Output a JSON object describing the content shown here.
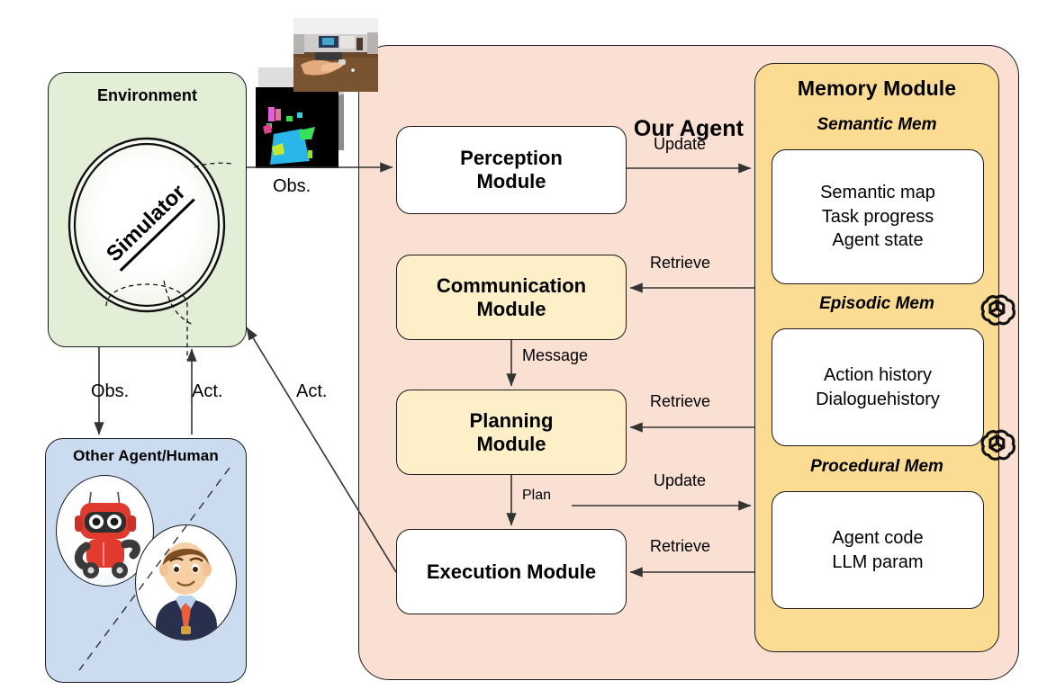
{
  "figure": {
    "title": "Agent architecture diagram"
  },
  "environment": {
    "title": "Environment",
    "simulator_label": "Simulator"
  },
  "other_agent": {
    "title": "Other Agent/Human",
    "robot_icon": "robot-avatar-icon",
    "human_icon": "human-avatar-icon"
  },
  "agent": {
    "title": "Our Agent",
    "modules": [
      {
        "id": "perception",
        "label": "Perception\nModule",
        "line1": "Perception",
        "line2": "Module",
        "llm": false
      },
      {
        "id": "communication",
        "label": "Communication\nModule",
        "line1": "Communication",
        "line2": "Module",
        "llm": true
      },
      {
        "id": "planning",
        "label": "Planning\nModule",
        "line1": "Planning",
        "line2": "Module",
        "llm": true
      },
      {
        "id": "execution",
        "label": "Execution Module",
        "line1": "Execution Module",
        "line2": "",
        "llm": false
      }
    ],
    "llm_icon": "openai-logo-icon"
  },
  "memory": {
    "title": "Memory Module",
    "sections": [
      {
        "id": "semantic",
        "heading": "Semantic Mem",
        "items": [
          "Semantic map",
          "Task progress",
          "Agent state"
        ]
      },
      {
        "id": "episodic",
        "heading": "Episodic Mem",
        "items": [
          "Action history",
          "Dialoguehistory"
        ]
      },
      {
        "id": "procedural",
        "heading": "Procedural Mem",
        "items": [
          "Agent code",
          "LLM param"
        ]
      }
    ]
  },
  "edges": {
    "obs_to_perception": "Obs.",
    "obs_to_other": "Obs.",
    "act_from_other": "Act.",
    "act_to_env": "Act.",
    "perception_update": "Update",
    "communication_retrieve": "Retrieve",
    "communication_message": "Message",
    "planning_retrieve": "Retrieve",
    "planning_plan": "Plan",
    "planning_update": "Update",
    "execution_retrieve": "Retrieve"
  },
  "thumbnails": [
    {
      "id": "depth-view",
      "name": "depth-observation-thumbnail"
    },
    {
      "id": "segmentation-view",
      "name": "segmentation-observation-thumbnail"
    },
    {
      "id": "rgb-view",
      "name": "rgb-observation-thumbnail"
    }
  ],
  "colors": {
    "agent_panel": "#fae0d2",
    "environment_panel": "#e2eed6",
    "other_panel": "#ccdcf0",
    "memory_panel": "#fbdc92",
    "llm_module": "#fdf0c9",
    "module": "#ffffff",
    "stroke": "#1a1a1a"
  }
}
